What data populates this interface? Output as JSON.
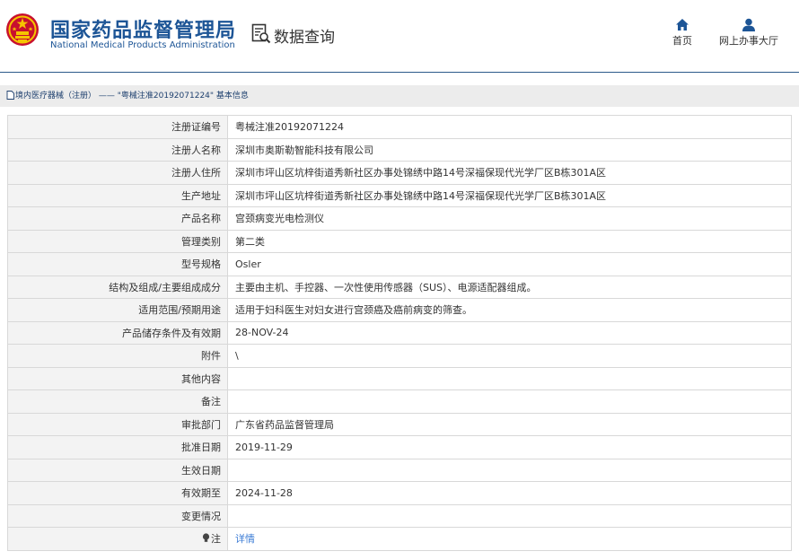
{
  "header": {
    "brand_cn": "国家药品监督管理局",
    "brand_en": "National Medical Products Administration",
    "data_query": "数据查询",
    "nav": {
      "home": "首页",
      "service_hall": "网上办事大厅"
    }
  },
  "breadcrumb": {
    "category": "境内医疗器械（注册）",
    "separator": "——",
    "record": "\"粤械注准20192071224\"",
    "section": "基本信息"
  },
  "detail": {
    "rows": [
      {
        "label": "注册证编号",
        "value": "粤械注准20192071224"
      },
      {
        "label": "注册人名称",
        "value": "深圳市奥斯勒智能科技有限公司"
      },
      {
        "label": "注册人住所",
        "value": "深圳市坪山区坑梓街道秀新社区办事处锦绣中路14号深福保现代光学厂区B栋301A区"
      },
      {
        "label": "生产地址",
        "value": "深圳市坪山区坑梓街道秀新社区办事处锦绣中路14号深福保现代光学厂区B栋301A区"
      },
      {
        "label": "产品名称",
        "value": "宫颈病变光电检测仪"
      },
      {
        "label": "管理类别",
        "value": "第二类"
      },
      {
        "label": "型号规格",
        "value": "Osler"
      },
      {
        "label": "结构及组成/主要组成成分",
        "value": "主要由主机、手控器、一次性使用传感器（SUS）、电源适配器组成。"
      },
      {
        "label": "适用范围/预期用途",
        "value": "适用于妇科医生对妇女进行宫颈癌及癌前病变的筛查。"
      },
      {
        "label": "产品储存条件及有效期",
        "value": "28-NOV-24"
      },
      {
        "label": "附件",
        "value": "\\"
      },
      {
        "label": "其他内容",
        "value": ""
      },
      {
        "label": "备注",
        "value": ""
      },
      {
        "label": "审批部门",
        "value": "广东省药品监督管理局"
      },
      {
        "label": "批准日期",
        "value": "2019-11-29"
      },
      {
        "label": "生效日期",
        "value": ""
      },
      {
        "label": "有效期至",
        "value": "2024-11-28"
      },
      {
        "label": "变更情况",
        "value": ""
      }
    ],
    "note_label": "注",
    "note_link": "详情"
  },
  "colors": {
    "brand": "#1d5596",
    "link": "#3a7bd5",
    "label_bg": "#f3f3f3",
    "breadcrumb_bg": "#ececec"
  },
  "icons": [
    "national-emblem-icon",
    "data-query-icon",
    "home-icon",
    "user-icon",
    "document-icon",
    "bulb-icon"
  ]
}
